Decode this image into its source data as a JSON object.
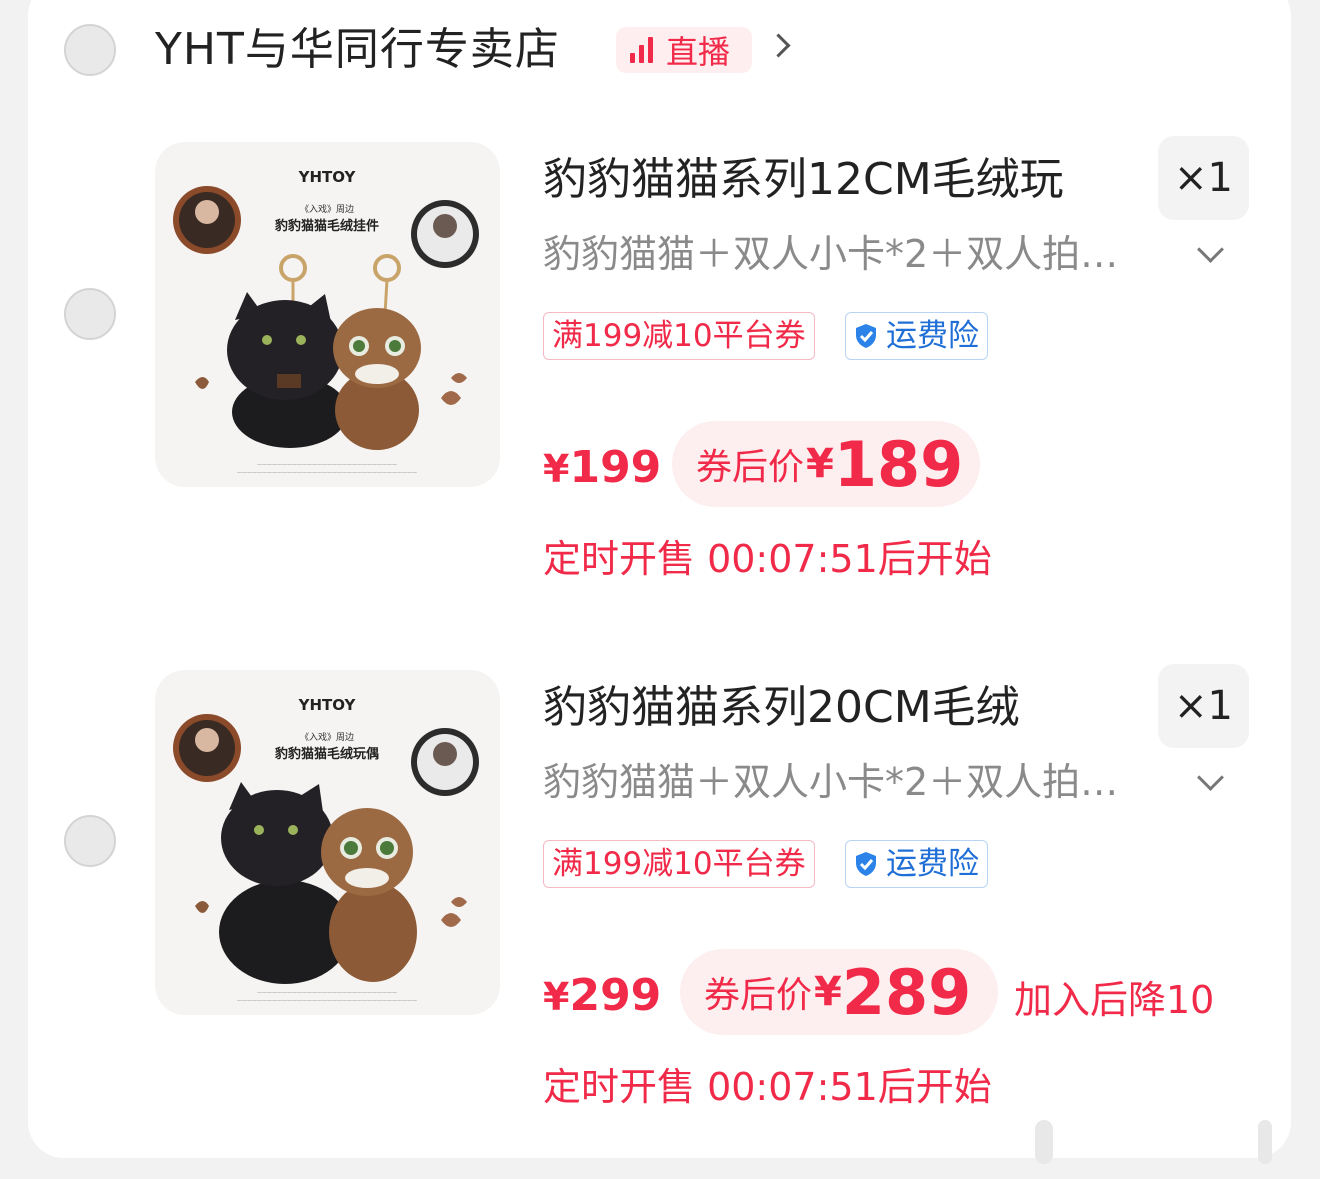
{
  "store": {
    "name": "YHT与华同行专卖店",
    "live_label": "直播"
  },
  "items": [
    {
      "title": "豹豹猫猫系列12CM毛绒玩",
      "quantity": "×1",
      "variant": "豹豹猫猫＋双人小卡*2＋双人拍…",
      "coupon_tag": "满199减10平台券",
      "shipping_tag": "运费险",
      "price": "199",
      "after_coupon_label": "券后价",
      "after_coupon_price": "189",
      "timer_text": "定时开售 00:07:51后开始",
      "image": {
        "brand": "YHTOY",
        "line1": "《入戏》周边",
        "line2": "豹豹猫猫毛绒挂件"
      }
    },
    {
      "title": "豹豹猫猫系列20CM毛绒",
      "quantity": "×1",
      "variant": "豹豹猫猫＋双人小卡*2＋双人拍…",
      "coupon_tag": "满199减10平台券",
      "shipping_tag": "运费险",
      "price": "299",
      "after_coupon_label": "券后价",
      "after_coupon_price": "289",
      "drop_note": "加入后降10",
      "timer_text": "定时开售 00:07:51后开始",
      "image": {
        "brand": "YHTOY",
        "line1": "《入戏》周边",
        "line2": "豹豹猫猫毛绒玩偶"
      }
    }
  ],
  "currency_symbol": "¥",
  "colors": {
    "accent_red": "#f02a48",
    "shipping_blue": "#1f6fd6",
    "background": "#f2f2f2",
    "card": "#ffffff"
  }
}
